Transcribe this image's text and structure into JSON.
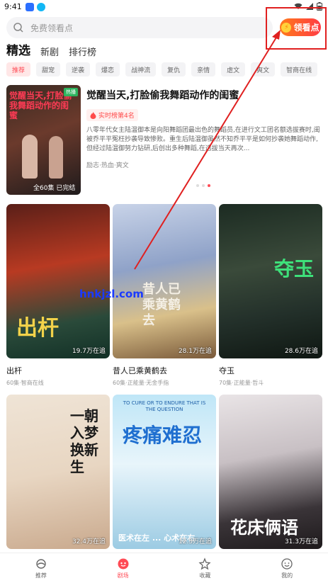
{
  "status_bar": {
    "time": "9:41"
  },
  "search": {
    "placeholder": "免费领看点"
  },
  "cta": {
    "label": "领看点",
    "coin_glyph": "⚡"
  },
  "tabs": [
    {
      "label": "精选",
      "active": true
    },
    {
      "label": "新剧",
      "active": false
    },
    {
      "label": "排行榜",
      "active": false
    }
  ],
  "chips": [
    "推荐",
    "甜宠",
    "逆袭",
    "爆恋",
    "战神流",
    "复仇",
    "亲情",
    "虐文",
    "爽文",
    "智商在线"
  ],
  "featured": {
    "poster_title": "觉醒当天,打脸偷我舞蹈动作的闺蜜",
    "poster_tag": "热播",
    "episodes_label": "全60集 已完结",
    "title": "觉醒当天,打脸偷我舞蹈动作的闺蜜",
    "badge": "实时榜第4名",
    "description": "八零年代女主陆温御本是向阳舞蹈团最出色的舞蹈员,在进行文工团名额选拔赛时,闺被乔平平冤枉抄袭导致惨败。重生后陆温御虽然不知乔平平是如何抄袭她舞蹈动作,但经过陆温御努力钻研,后创出多种舞蹈,在选拔当天再次...",
    "tags": "励志·热血·爽文"
  },
  "cards": [
    {
      "title": "出杆",
      "meta": "60集·智商在线",
      "count": "19.7万在追",
      "poster_word": "出杆"
    },
    {
      "title": "昔人已乘黄鹤去",
      "meta": "60集·正能量·无金手指",
      "count": "28.1万在追",
      "poster_word": "昔人已乘黄鹤去"
    },
    {
      "title": "夺玉",
      "meta": "70集·正能量·哲斗",
      "count": "28.6万在追",
      "poster_word": "夺玉"
    },
    {
      "title": "",
      "meta": "",
      "count": "32.4万在追",
      "poster_word": "一朝入梦换新生"
    },
    {
      "title": "",
      "meta": "",
      "count": "12.3万在追",
      "poster_word": "疼痛难忍",
      "poster_sub": "TO CURE OR TO ENDURE THAT IS THE QUESTION",
      "poster_names": "医术在左 ... 心术在右"
    },
    {
      "title": "",
      "meta": "",
      "count": "31.3万在追",
      "poster_word": "花床俩语"
    }
  ],
  "watermark": "hnkjzl.com",
  "bottom_nav": [
    {
      "label": "推荐",
      "icon": "recommend-icon",
      "active": false
    },
    {
      "label": "剧场",
      "icon": "theater-icon",
      "active": true
    },
    {
      "label": "收藏",
      "icon": "star-icon",
      "active": false
    },
    {
      "label": "我的",
      "icon": "profile-icon",
      "active": false
    }
  ]
}
